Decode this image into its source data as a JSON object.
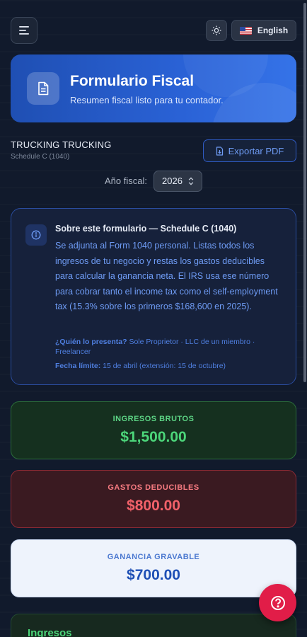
{
  "topbar": {
    "menu_icon": "hamburger-menu-icon",
    "theme_icon": "sun-icon",
    "language_label": "English",
    "language_flag": "us-flag-icon"
  },
  "hero": {
    "icon": "document-icon",
    "title": "Formulario Fiscal",
    "subtitle": "Resumen fiscal listo para tu contador."
  },
  "business": {
    "name": "TRUCKING TRUCKING",
    "form": "Schedule C (1040)"
  },
  "export_button": {
    "label": "Exportar PDF",
    "icon": "file-download-icon"
  },
  "fiscal_year": {
    "label": "Año fiscal:",
    "value": "2026"
  },
  "info": {
    "title": "Sobre este formulario — Schedule C (1040)",
    "body": "Se adjunta al Form 1040 personal. Listas todos los ingresos de tu negocio y restas los gastos deducibles para calcular la ganancia neta. El IRS usa ese número para cobrar tanto el income tax como el self-employment tax (15.3% sobre los primeros $168,600 en 2025).",
    "who_label": "¿Quién lo presenta?",
    "who_value": "Sole Proprietor · LLC de un miembro · Freelancer",
    "deadline_label": "Fecha límite:",
    "deadline_value": "15 de abril (extensión: 15 de octubre)"
  },
  "stats": {
    "income": {
      "label": "INGRESOS BRUTOS",
      "value": "$1,500.00"
    },
    "expenses": {
      "label": "GASTOS DEDUCIBLES",
      "value": "$800.00"
    },
    "profit": {
      "label": "GANANCIA GRAVABLE",
      "value": "$700.00"
    }
  },
  "section": {
    "title": "Ingresos"
  },
  "colors": {
    "accent_blue": "#2a62d6",
    "income_green": "#4cd67a",
    "expense_red": "#f26169",
    "help_red": "#e11d48"
  }
}
